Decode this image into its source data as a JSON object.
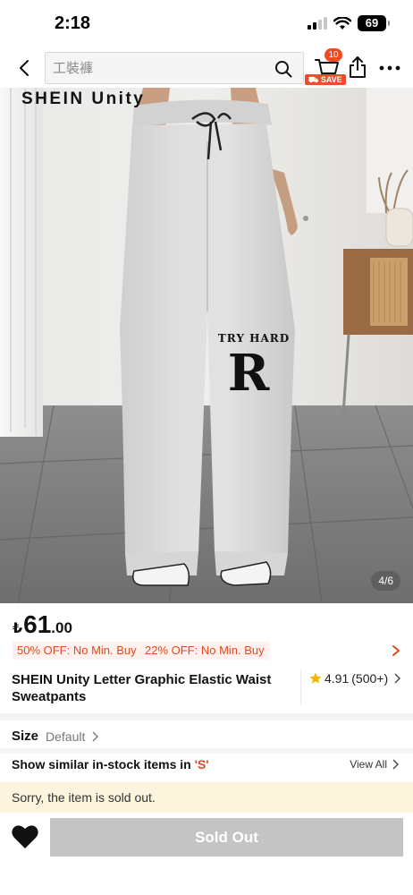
{
  "status_bar": {
    "time": "2:18",
    "battery": "69"
  },
  "nav": {
    "search": {
      "placeholder": "工裝褲"
    },
    "cart_count": "10",
    "save_label": "SAVE"
  },
  "hero": {
    "brand": "SHEIN Unity",
    "print_text": "TRY HARD",
    "print_letter": "R",
    "counter": "4/6"
  },
  "product": {
    "price": {
      "currency": "₺",
      "integer": "61",
      "decimal": ".00"
    },
    "promos": [
      "50% OFF: No Min. Buy",
      "22% OFF: No Min. Buy"
    ],
    "title": "SHEIN Unity Letter Graphic Elastic Waist Sweatpants",
    "rating": {
      "score": "4.91",
      "count": "(500+)"
    }
  },
  "size": {
    "label": "Size",
    "value": "Default"
  },
  "similar": {
    "text": "Show similar in-stock items in ",
    "size": "'S'",
    "view_all": "View All"
  },
  "notice": "Sorry, the item is sold out.",
  "actions": {
    "button": "Sold Out"
  },
  "colors": {
    "accent": "#e2481e",
    "promo_bg": "#fff1ee",
    "notice_bg": "#fdf4de",
    "disabled_button": "#c4c4c4"
  }
}
